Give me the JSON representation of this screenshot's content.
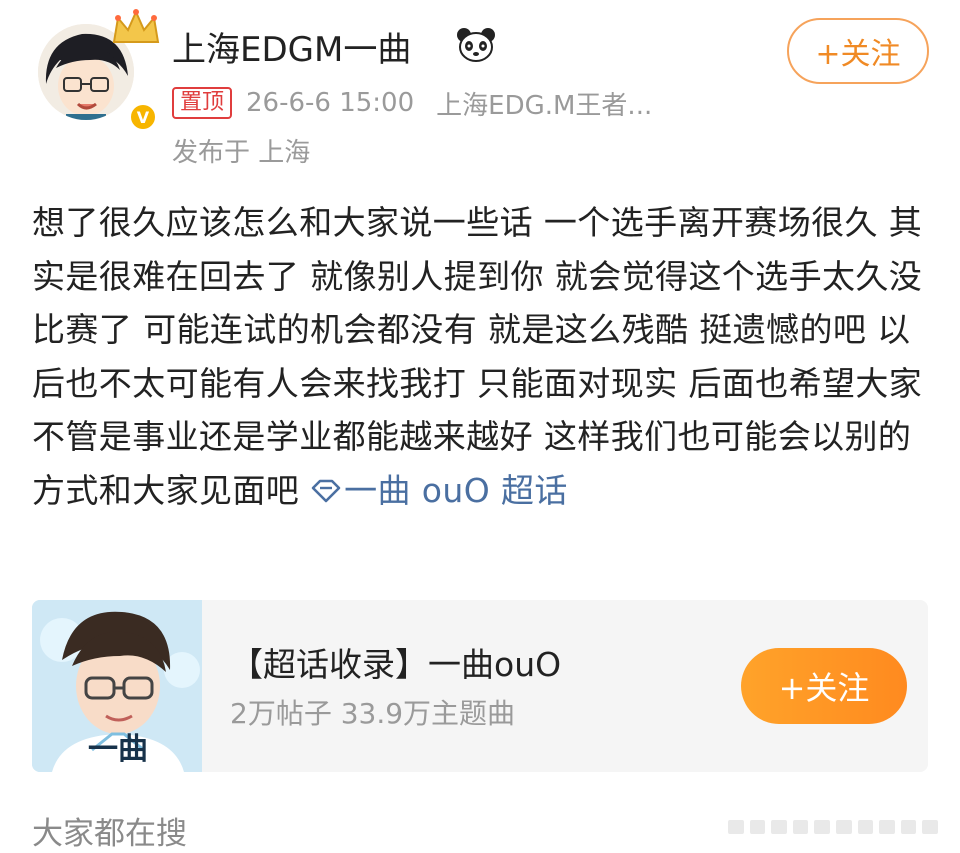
{
  "header": {
    "username": "上海EDGM一曲",
    "pinned_label": "置顶",
    "time": "26-6-6 15:00",
    "source": "上海EDG.M王者...",
    "location": "发布于 上海",
    "follow_label": "+关注",
    "avatar_icon": "avatar-illustration",
    "badge_icon": "verified-v-icon",
    "emoji_icon": "panda-icon"
  },
  "post": {
    "text": "想了很久应该怎么和大家说一些话 一个选手离开赛场很久 其实是很难在回去了 就像别人提到你 就会觉得这个选手太久没比赛了 可能连试的机会都没有 就是这么残酷 挺遗憾的吧  以后也不太可能有人会来找我打 只能面对现实 后面也希望大家不管是事业还是学业都能越来越好 这样我们也可能会以别的方式和大家见面吧 ",
    "topic_link": "一曲 ouO 超话"
  },
  "card": {
    "title": "【超话收录】一曲ouO",
    "subtitle": "2万帖子 33.9万主题曲",
    "follow_label": "+关注",
    "thumb_caption": "一曲"
  },
  "footer": {
    "section_label": "大家都在搜"
  },
  "colors": {
    "accent": "#f08a25",
    "link": "#4a6fa1",
    "pin": "#e03d3d",
    "muted": "#9a9a9a"
  }
}
